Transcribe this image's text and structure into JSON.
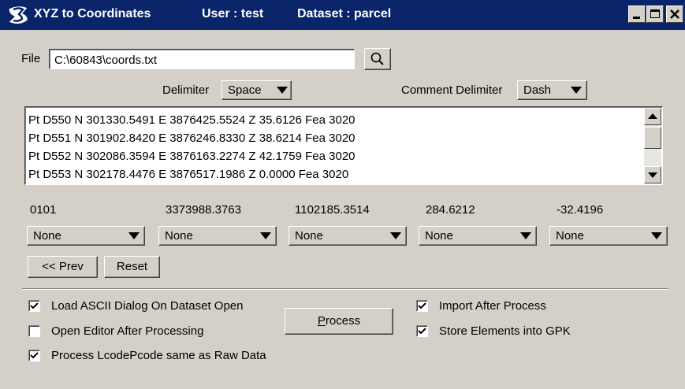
{
  "window": {
    "title": "XYZ to Coordinates",
    "user": "User : test",
    "dataset": "Dataset : parcel",
    "titlebar_color": "#0a246a",
    "icons": [
      "minimize-icon",
      "maximize-icon",
      "close-icon"
    ]
  },
  "file": {
    "label": "File",
    "value": "C:\\60843\\coords.txt",
    "browse_icon": "magnifier-icon"
  },
  "delimiter": {
    "label": "Delimiter",
    "value": "Space"
  },
  "comment_delimiter": {
    "label": "Comment Delimiter",
    "value": "Dash"
  },
  "data_lines": [
    "Pt D550 N 301330.5491 E 3876425.5524 Z 35.6126 Fea 3020",
    "Pt D551 N 301902.8420 E 3876246.8330 Z 38.6214 Fea 3020",
    "Pt D552 N 302086.3594 E 3876163.2274 Z 42.1759 Fea 3020",
    "Pt D553 N 302178.4476 E 3876517.1986 Z 0.0000 Fea 3020"
  ],
  "columns": [
    {
      "value": "0101",
      "mapping": "None"
    },
    {
      "value": "3373988.3763",
      "mapping": "None"
    },
    {
      "value": "1102185.3514",
      "mapping": "None"
    },
    {
      "value": "284.6212",
      "mapping": "None"
    },
    {
      "value": "-32.4196",
      "mapping": "None"
    }
  ],
  "buttons": {
    "prev": "<< Prev",
    "reset": "Reset",
    "process_mnemonic": "P",
    "process_rest": "rocess"
  },
  "options": {
    "load_ascii": {
      "label": "Load ASCII Dialog On Dataset Open",
      "checked": true
    },
    "open_editor": {
      "label": "Open Editor After Processing",
      "checked": false
    },
    "process_lcode": {
      "label": "Process LcodePcode same as Raw Data",
      "checked": true
    },
    "import_after": {
      "label": "Import After Process",
      "checked": true
    },
    "store_gpk": {
      "label": "Store Elements into GPK",
      "checked": true
    }
  }
}
